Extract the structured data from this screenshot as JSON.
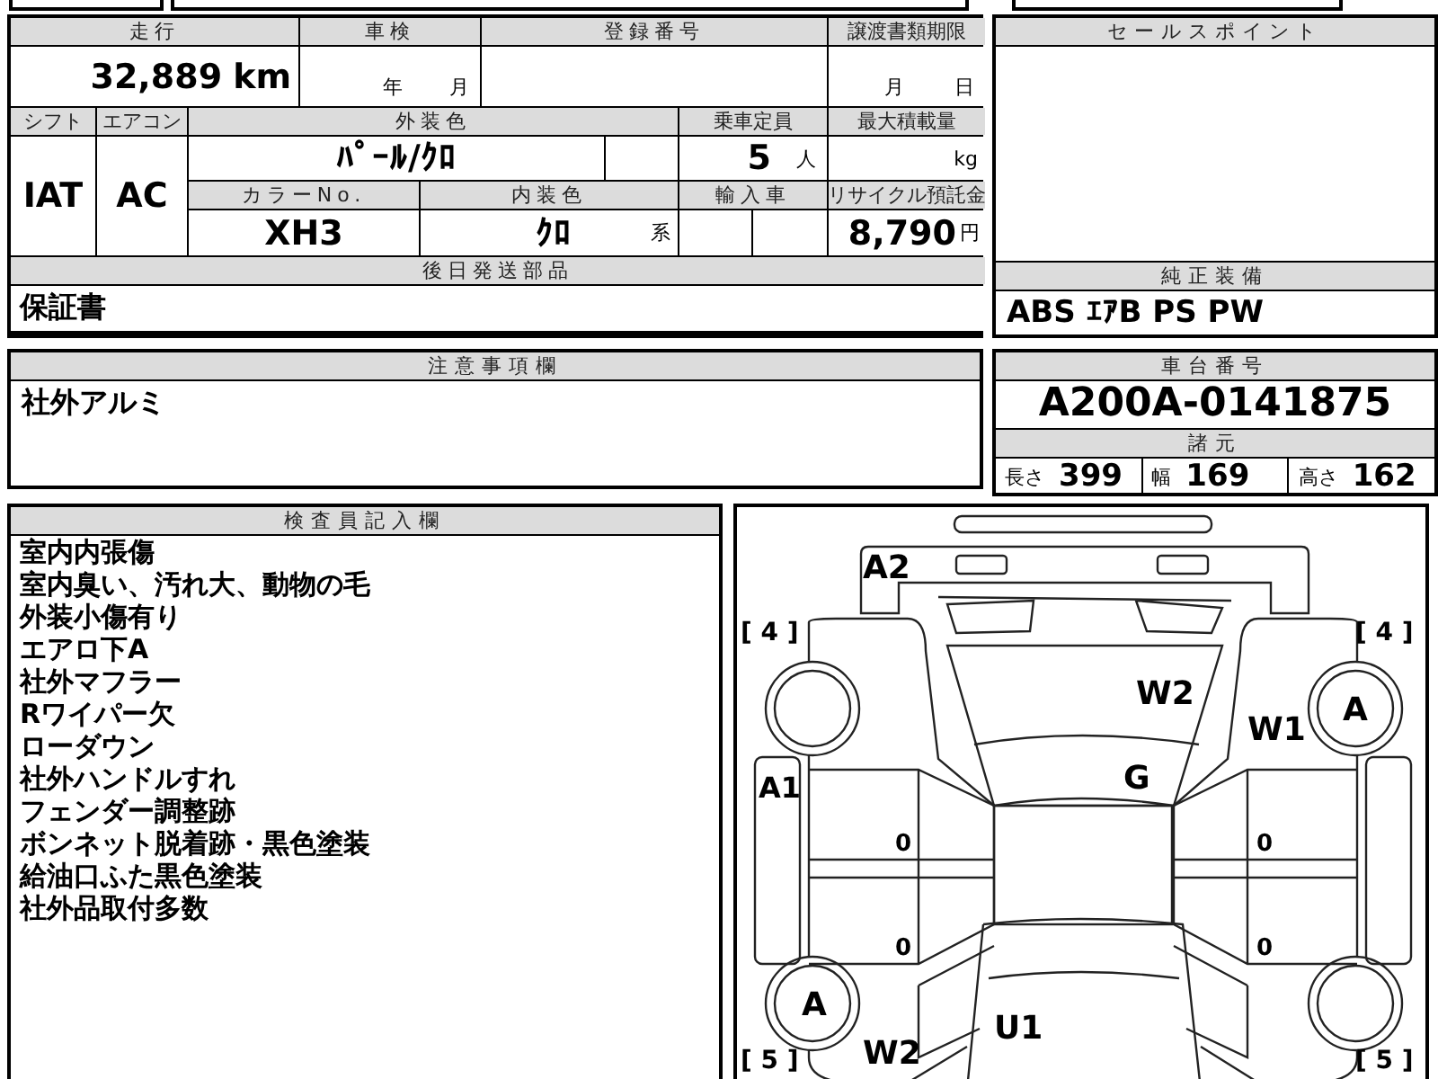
{
  "vehicle_table": {
    "mileage": {
      "label": "走行",
      "value": "32,889",
      "unit": "km"
    },
    "inspection": {
      "label": "車検",
      "year_unit": "年",
      "month_unit": "月"
    },
    "registration": {
      "label": "登録番号"
    },
    "transfer_deadline": {
      "label": "譲渡書類期限",
      "month_unit": "月",
      "day_unit": "日"
    },
    "shift": {
      "label": "シフト",
      "value": "IAT"
    },
    "aircon": {
      "label": "エアコン",
      "value": "AC"
    },
    "exterior_color": {
      "label": "外装色",
      "value": "ﾊﾟｰﾙ/ｸﾛ"
    },
    "capacity": {
      "label": "乗車定員",
      "value": "5",
      "unit": "人"
    },
    "max_load": {
      "label": "最大積載量",
      "unit": "kg"
    },
    "color_no": {
      "label": "カラーNo.",
      "value": "XH3"
    },
    "interior_color": {
      "label": "内装色",
      "value": "ｸﾛ",
      "suffix": "系"
    },
    "imported": {
      "label": "輸入車"
    },
    "recycle_fee": {
      "label": "リサイクル預託金",
      "value": "8,790",
      "unit": "円"
    },
    "later_parts": {
      "label": "後日発送部品",
      "value": "保証書"
    }
  },
  "notes": {
    "label": "注意事項欄",
    "value": "社外アルミ"
  },
  "sale_points": {
    "label": "セールスポイント"
  },
  "equipment": {
    "label": "純正装備",
    "value": "ABS ｴｱB PS PW"
  },
  "chassis": {
    "label": "車台番号",
    "value": "A200A-0141875"
  },
  "specs": {
    "label": "諸元",
    "items": [
      {
        "label": "長さ",
        "value": "399"
      },
      {
        "label": "幅",
        "value": "169"
      },
      {
        "label": "高さ",
        "value": "162"
      }
    ]
  },
  "inspector": {
    "label": "検査員記入欄",
    "lines": [
      "室内内張傷",
      "室内臭い、汚れ大、動物の毛",
      "外装小傷有り",
      "エアロ下A",
      "社外マフラー",
      "Rワイパー欠",
      "ローダウン",
      "社外ハンドルすれ",
      "フェンダー調整跡",
      "ボンネット脱着跡・黒色塗装",
      "給油口ふた黒色塗装",
      "社外品取付多数"
    ]
  },
  "diagram": {
    "marks": [
      {
        "text": "A2"
      },
      {
        "text": "[ 4 ]"
      },
      {
        "text": "[ 4 ]"
      },
      {
        "text": "W2"
      },
      {
        "text": "W1"
      },
      {
        "text": "A"
      },
      {
        "text": "A1"
      },
      {
        "text": "G"
      },
      {
        "text": "0"
      },
      {
        "text": "0"
      },
      {
        "text": "0"
      },
      {
        "text": "0"
      },
      {
        "text": "A"
      },
      {
        "text": "U1"
      },
      {
        "text": "[ 5 ]"
      },
      {
        "text": "W2"
      },
      {
        "text": "[ 5 ]"
      }
    ]
  }
}
